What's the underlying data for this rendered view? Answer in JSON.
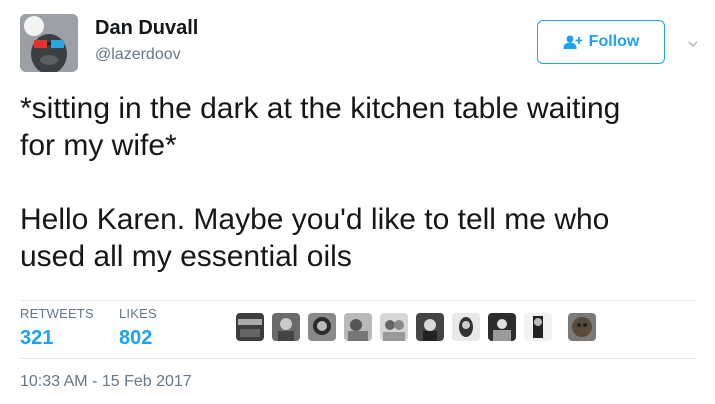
{
  "author": {
    "display_name": "Dan Duvall",
    "screen_name": "@lazerdoov"
  },
  "follow_button": {
    "label": "Follow",
    "icon": "add-user-icon"
  },
  "tweet": {
    "text": "*sitting in the dark at the kitchen table waiting\nfor my wife*\n\nHello Karen. Maybe you'd like to tell me who\nused all my essential oils"
  },
  "stats": {
    "retweets_label": "RETWEETS",
    "retweets_count": "321",
    "likes_label": "LIKES",
    "likes_count": "802"
  },
  "liker_avatars": [
    "avatar-1",
    "avatar-2",
    "avatar-3",
    "avatar-4",
    "avatar-5",
    "avatar-6",
    "avatar-7",
    "avatar-8",
    "avatar-9",
    "avatar-10"
  ],
  "timestamp": "10:33 AM - 15 Feb 2017",
  "colors": {
    "accent": "#1da1f2",
    "text": "#14171a",
    "secondary": "#657786",
    "divider": "#e1e8ed"
  }
}
